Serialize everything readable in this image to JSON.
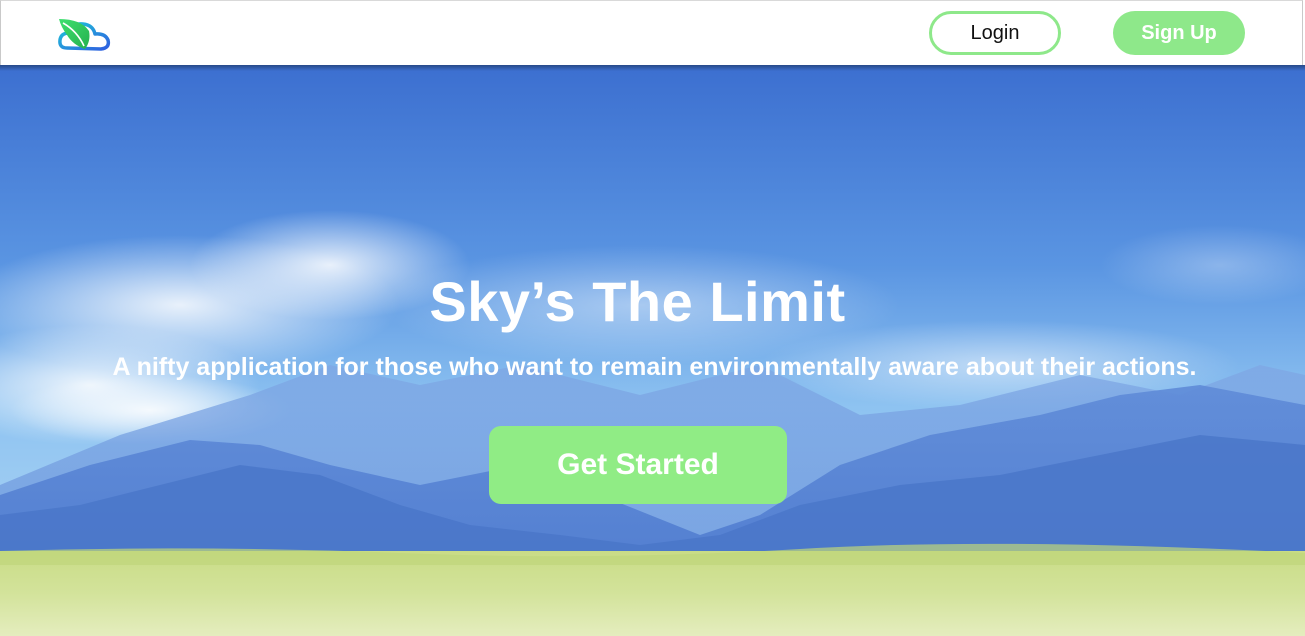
{
  "header": {
    "logo_icon": "leaf-cloud-logo-icon",
    "login_label": "Login",
    "signup_label": "Sign Up"
  },
  "hero": {
    "title": "Sky’s The Limit",
    "subtitle": "A nifty application for those who want to remain environmentally aware about their actions.",
    "cta_label": "Get Started",
    "background": "mountains-sky-meadow-image"
  },
  "colors": {
    "accent_green": "#8ee88a",
    "logo_blue": "#2f7ee0",
    "logo_green": "#3ed86a",
    "sky_blue": "#3f7ad6"
  }
}
